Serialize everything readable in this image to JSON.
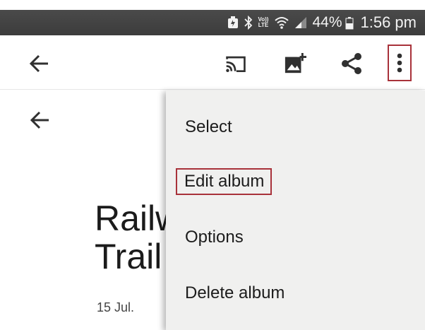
{
  "status_bar": {
    "battery_percent": "44%",
    "time": "1:56 pm",
    "lte_label_top": "Vo))",
    "lte_label_bottom": "LTE"
  },
  "toolbar": {
    "icons": [
      "back-arrow-icon",
      "cast-icon",
      "add-photo-icon",
      "share-icon",
      "more-vert-icon"
    ]
  },
  "album": {
    "title": "Railway\nTrail",
    "date": "15 Jul."
  },
  "menu": {
    "items": [
      {
        "label": "Select"
      },
      {
        "label": "Edit album",
        "highlighted": true
      },
      {
        "label": "Options"
      },
      {
        "label": "Delete album"
      }
    ]
  },
  "colors": {
    "highlight_border": "#a8323a",
    "status_bar_bg": "#444444",
    "menu_bg": "#f0f0ef"
  }
}
